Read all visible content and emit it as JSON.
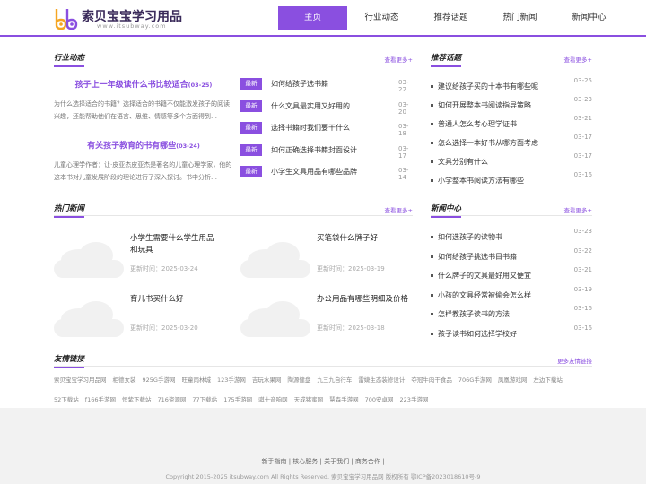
{
  "header": {
    "logo_title": "索贝宝宝学习用品",
    "logo_sub": "www.itsubway.com",
    "nav": [
      "主页",
      "行业动态",
      "推荐话题",
      "热门新闻",
      "新闻中心"
    ]
  },
  "industry": {
    "title": "行业动态",
    "more": "查看更多+",
    "featured": [
      {
        "title": "孩子上一年级读什么书比较适合",
        "date": "(03-25)",
        "desc": "为什么选择适合的书籍？选择适合的书籍不仅能激发孩子的阅读兴趣，还能帮助他们在语言、思维、情感等多个方面得到…"
      },
      {
        "title": "有关孩子教育的书有哪些",
        "date": "(03-24)",
        "desc": "儿童心理学作者：让·皮亚杰皮亚杰是著名的儿童心理学家，他的这本书对儿童发展阶段的理论进行了深入探讨。书中分析…"
      }
    ],
    "badge": "最新",
    "list": [
      {
        "text": "如何给孩子选书籍",
        "date": "03-22"
      },
      {
        "text": "什么文具最实用又好用的",
        "date": "03-20"
      },
      {
        "text": "选择书籍时我们要干什么",
        "date": "03-18"
      },
      {
        "text": "如何正确选择书籍封面设计",
        "date": "03-17"
      },
      {
        "text": "小学生文具用品有哪些品牌",
        "date": "03-14"
      }
    ]
  },
  "recommend": {
    "title": "推荐话题",
    "more": "查看更多+",
    "list": [
      {
        "text": "建议给孩子买的十本书有哪些呢",
        "date": "03-25"
      },
      {
        "text": "如何开展整本书阅读指导策略",
        "date": "03-23"
      },
      {
        "text": "普通人怎么考心理学证书",
        "date": "03-21"
      },
      {
        "text": "怎么选择一本好书从哪方面考虑",
        "date": "03-17"
      },
      {
        "text": "文具分别有什么",
        "date": "03-17"
      },
      {
        "text": "小学整本书阅读方法有哪些",
        "date": "03-16"
      }
    ]
  },
  "hot": {
    "title": "热门新闻",
    "more": "查看更多+",
    "date_prefix": "更新时间：",
    "items": [
      {
        "title": "小学生需要什么学生用品和玩具",
        "date": "2025-03-24"
      },
      {
        "title": "买笔袋什么牌子好",
        "date": "2025-03-19"
      },
      {
        "title": "育儿书买什么好",
        "date": "2025-03-20"
      },
      {
        "title": "办公用品有哪些明细及价格",
        "date": "2025-03-18"
      }
    ]
  },
  "news_center": {
    "title": "新闻中心",
    "more": "查看更多+",
    "list": [
      {
        "text": "如何选孩子的读物书",
        "date": "03-23"
      },
      {
        "text": "如何给孩子挑选书目书籍",
        "date": "03-22"
      },
      {
        "text": "什么牌子的文具最好用又便宜",
        "date": "03-21"
      },
      {
        "text": "小孩的文具经常被偷会怎么样",
        "date": "03-19"
      },
      {
        "text": "怎样教孩子读书的方法",
        "date": "03-16"
      },
      {
        "text": "孩子读书如何选择学校好",
        "date": "03-16"
      }
    ]
  },
  "friend_links": {
    "title": "友情链接",
    "more": "更多友情链接",
    "items": [
      "索贝宝宝学习用品网",
      "相德女装",
      "925G手游网",
      "旺童雨林城",
      "123手游网",
      "吉玩水果网",
      "陶源健盘",
      "九三九自行车",
      "雷婕生态装修设计",
      "夺冠牛肉干食品",
      "706G手游网",
      "凤凰游戏网",
      "左边下载站",
      "52下载站",
      "f166手游网",
      "恒紫下载站",
      "716资源网",
      "77下载站",
      "175手游网",
      "骐士音响网",
      "天成猪蜜网",
      "慧森手游网",
      "700安卓网",
      "223手游网"
    ]
  },
  "footer": {
    "links": "新手指南 | 核心服务 | 关于我们 | 商务合作 |",
    "copyright": "Copyright 2015-2025 itsubway.com All Rights Reserved. 索贝宝宝学习用品网 版权所有 鄂ICP备2023018610号-9"
  }
}
